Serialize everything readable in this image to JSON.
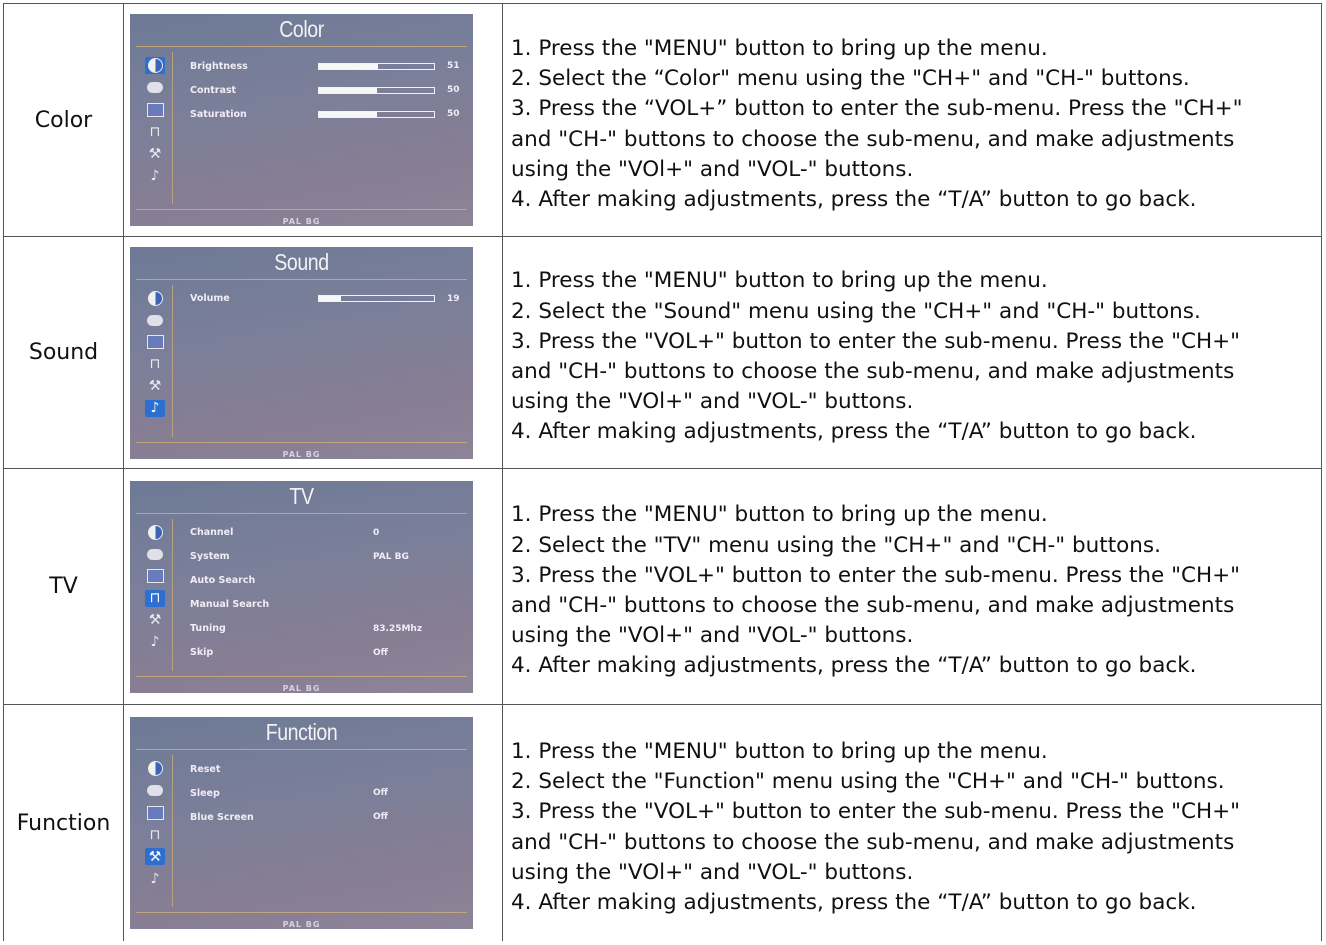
{
  "rows": [
    {
      "name": "Color",
      "osd": {
        "title": "Color",
        "footer": "PAL BG",
        "selected_icon": 0,
        "items": [
          {
            "label": "Brightness",
            "level": 51,
            "value": "51"
          },
          {
            "label": "Contrast",
            "level": 50,
            "value": "50"
          },
          {
            "label": "Saturation",
            "level": 50,
            "value": "50"
          }
        ]
      },
      "lines": [
        "1. Press the \"MENU\" button to bring up the menu.",
        "2. Select the “Color\" menu using the \"CH+\" and \"CH-\" buttons.",
        "3. Press the “VOL+” button to enter the sub-menu. Press the \"CH+\"",
        "and \"CH-\" buttons to choose the sub-menu, and make adjustments",
        "using the \"VOl+\" and \"VOL-\" buttons.",
        "4. After making adjustments, press the “T/A” button to go back."
      ]
    },
    {
      "name": "Sound",
      "osd": {
        "title": "Sound",
        "footer": "PAL BG",
        "selected_icon": 5,
        "items": [
          {
            "label": "Volume",
            "level": 19,
            "value": "19"
          }
        ]
      },
      "lines": [
        "1. Press the \"MENU\" button to bring up the menu.",
        "2. Select the \"Sound\" menu using the \"CH+\" and \"CH-\" buttons.",
        "3. Press the \"VOL+\" button to enter the sub-menu. Press the \"CH+\"",
        "and \"CH-\" buttons to choose the sub-menu, and make adjustments",
        "using the \"VOl+\" and \"VOL-\" buttons.",
        "4. After making adjustments, press the “T/A” button to go back."
      ]
    },
    {
      "name": "TV",
      "osd": {
        "title": "TV",
        "footer": "PAL BG",
        "selected_icon": 3,
        "items": [
          {
            "label": "Channel",
            "value": "0"
          },
          {
            "label": "System",
            "value": "PAL BG"
          },
          {
            "label": "Auto Search",
            "value": ""
          },
          {
            "label": "Manual Search",
            "value": ""
          },
          {
            "label": "Tuning",
            "value": "83.25Mhz"
          },
          {
            "label": "Skip",
            "value": "Off"
          }
        ]
      },
      "lines": [
        "1. Press the \"MENU\" button to bring up the menu.",
        "2. Select the \"TV\" menu using the \"CH+\" and \"CH-\" buttons.",
        "3. Press the \"VOL+\" button to enter the sub-menu. Press the \"CH+\"",
        "and \"CH-\" buttons to choose the sub-menu, and make adjustments",
        "using the \"VOl+\" and \"VOL-\" buttons.",
        "4. After making adjustments, press the “T/A” button to go back."
      ]
    },
    {
      "name": "Function",
      "osd": {
        "title": "Function",
        "footer": "PAL BG",
        "selected_icon": 4,
        "items": [
          {
            "label": "Reset",
            "value": ""
          },
          {
            "label": "Sleep",
            "value": "Off"
          },
          {
            "label": "Blue Screen",
            "value": "Off"
          }
        ]
      },
      "lines": [
        "1. Press the \"MENU\" button to bring up the menu.",
        "2. Select the \"Function\" menu using the \"CH+\" and \"CH-\" buttons.",
        "3. Press the \"VOL+\" button to enter the sub-menu. Press the \"CH+\"",
        "and \"CH-\" buttons to choose the sub-menu, and make adjustments",
        "using the \"VOl+\" and \"VOL-\" buttons.",
        "4. After making adjustments, press the “T/A” button to go back."
      ]
    }
  ],
  "osd_icons": [
    "color-icon",
    "picture-icon",
    "image-icon",
    "tv-icon",
    "function-icon",
    "sound-icon"
  ]
}
